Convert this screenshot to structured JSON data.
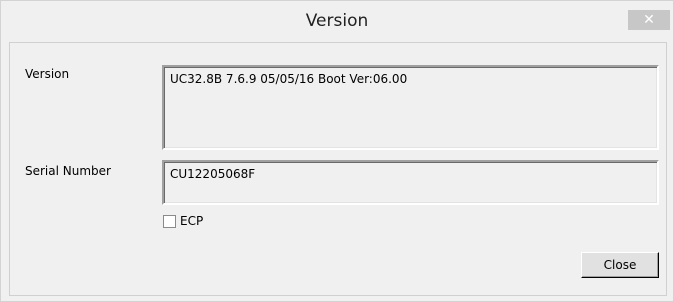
{
  "window": {
    "title": "Version",
    "close_glyph": "✕"
  },
  "form": {
    "version_label": "Version",
    "version_value": "UC32.8B 7.6.9 05/05/16 Boot Ver:06.00",
    "serial_label": "Serial Number",
    "serial_value": "CU12205068F",
    "ecp_label": "ECP",
    "ecp_checked": false
  },
  "buttons": {
    "close_label": "Close"
  }
}
